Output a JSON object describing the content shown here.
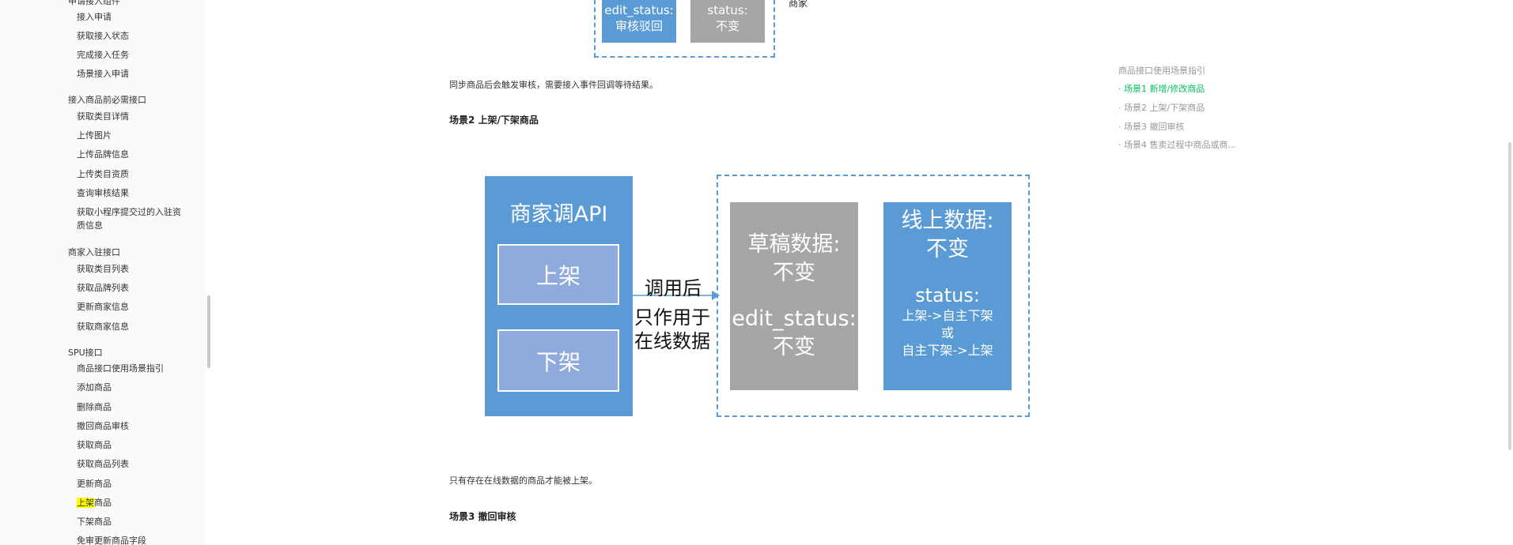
{
  "sidebar": {
    "top_partial": "申请接入组件",
    "groups": [
      {
        "title": "",
        "items": [
          "接入申请",
          "获取接入状态",
          "完成接入任务",
          "场景接入申请"
        ]
      },
      {
        "title": "接入商品前必需接口",
        "items": [
          "获取类目详情",
          "上传图片",
          "上传品牌信息",
          "上传类目资质",
          "查询审核结果",
          "获取小程序提交过的入驻资质信息"
        ]
      },
      {
        "title": "商家入驻接口",
        "items": [
          "获取类目列表",
          "获取品牌列表",
          "更新商家信息",
          "获取商家信息"
        ]
      },
      {
        "title": "SPU接口",
        "items": [
          "商品接口使用场景指引",
          "添加商品",
          "删除商品",
          "撤回商品审核",
          "获取商品",
          "获取商品列表",
          "更新商品",
          "上架商品",
          "下架商品",
          "免审更新商品字段"
        ]
      }
    ],
    "highlight_prefix": "上架",
    "highlight_suffix": "商品"
  },
  "diagram1": {
    "box1_line1": "edit_status:",
    "box1_line2": "审核驳回",
    "box2_line1": "status:",
    "box2_line2": "不变",
    "side_label": "商家"
  },
  "main": {
    "para1": "同步商品后会触发审核，需要接入事件回调等待结果。",
    "heading2": "场景2 上架/下架商品",
    "para2": "只有存在在线数据的商品才能被上架。",
    "heading3": "场景3 撤回审核"
  },
  "diagram2": {
    "api_title": "商家调API",
    "btn_up": "上架",
    "btn_down": "下架",
    "arrow_l1": "调用后",
    "arrow_l2": "只作用于",
    "arrow_l3": "在线数据",
    "draft_l1": "草稿数据:",
    "draft_l2": "不变",
    "draft_l3": "edit_status:",
    "draft_l4": "不变",
    "online_l1": "线上数据:",
    "online_l2": "不变",
    "online_l3": "status:",
    "online_l4": "上架->自主下架",
    "online_l5": "或",
    "online_l6": "自主下架->上架"
  },
  "toc": {
    "title": "商品接口使用场景指引",
    "items": [
      "· 场景1 新增/修改商品",
      "· 场景2 上架/下架商品",
      "· 场景3 撤回审核",
      "· 场景4 售卖过程中商品或商..."
    ]
  },
  "colors": {
    "diagram_blue": "#5b9bd5",
    "button_blue": "#8faadc",
    "diagram_gray": "#a6a6a6",
    "toc_active": "#07c160",
    "highlight": "#ffff00"
  }
}
